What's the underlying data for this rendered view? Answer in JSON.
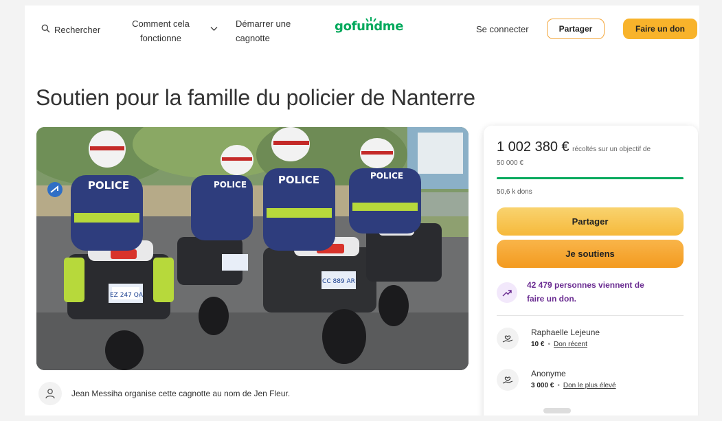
{
  "header": {
    "search_label": "Rechercher",
    "how_line1": "Comment cela",
    "how_line2": "fonctionne",
    "start_line1": "Démarrer une",
    "start_line2": "cagnotte",
    "logo_text": "gofundme",
    "login_label": "Se connecter",
    "share_label": "Partager",
    "donate_label": "Faire un don"
  },
  "campaign": {
    "title": "Soutien pour la famille du policier de Nanterre",
    "image_alt": "Photo de policiers à moto",
    "organizer_text": "Jean Messiha organise cette cagnotte au nom de Jen Fleur."
  },
  "donation_card": {
    "amount": "1 002 380 €",
    "amount_sub_part1": "récoltés sur un objectif de",
    "amount_sub_part2": "50 000 €",
    "progress_fraction": 1.0,
    "donors_count": "50,6 k dons",
    "share_button": "Partager",
    "support_button": "Je soutiens",
    "trend_line1": "42 479 personnes viennent de",
    "trend_line2": "faire un don.",
    "donations": [
      {
        "name": "Raphaelle Lejeune",
        "amount": "10 €",
        "tag": "Don récent"
      },
      {
        "name": "Anonyme",
        "amount": "3 000 €",
        "tag": "Don le plus élevé"
      }
    ]
  },
  "colors": {
    "brand_green": "#02a95c",
    "accent_yellow": "#f8b32b",
    "trend_purple": "#6a2c91"
  },
  "icons": {
    "search": "search-icon",
    "chevron": "chevron-down-icon",
    "trend": "trending-up-icon",
    "donor": "hand-heart-icon",
    "organizer": "user-icon"
  }
}
